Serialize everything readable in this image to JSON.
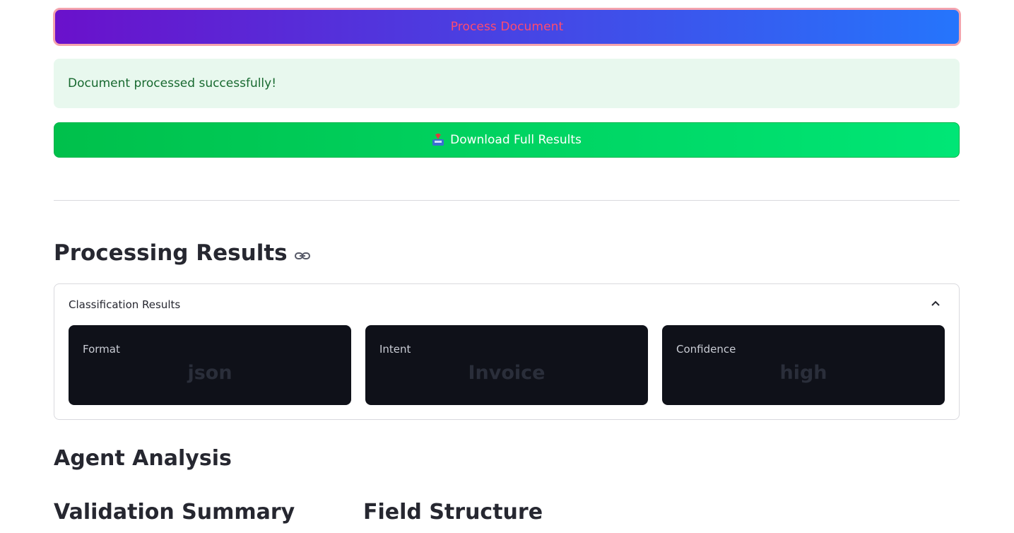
{
  "actions": {
    "process_label": "Process Document",
    "download_label": "Download Full Results"
  },
  "alert": {
    "success_message": "Document processed successfully!"
  },
  "results": {
    "title": "Processing Results",
    "expander_label": "Classification Results",
    "metrics": [
      {
        "label": "Format",
        "value": "json"
      },
      {
        "label": "Intent",
        "value": "Invoice"
      },
      {
        "label": "Confidence",
        "value": "high"
      }
    ]
  },
  "sections": {
    "agent_analysis": "Agent Analysis",
    "validation_summary": "Validation Summary",
    "field_structure": "Field Structure"
  },
  "icons": {
    "download": "inbox-tray-icon",
    "heading_anchor": "link-icon",
    "expander_toggle": "chevron-up-icon"
  },
  "colors": {
    "process_gradient_start": "#6a11cb",
    "process_gradient_end": "#2575fc",
    "process_text": "#ff4b6e",
    "success_bg": "#e8f8ee",
    "success_text": "#17692f",
    "download_gradient_start": "#00c04b",
    "download_gradient_end": "#00e676",
    "metric_card_bg": "#0f1119"
  }
}
